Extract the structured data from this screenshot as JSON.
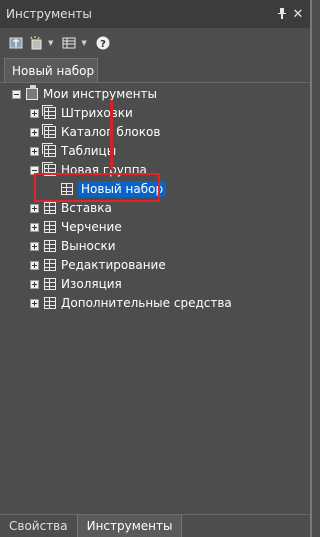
{
  "window": {
    "title": "Инструменты",
    "pin_symbol": "ᵽ",
    "close_symbol": "✕"
  },
  "toolbar": {
    "icons": [
      "properties-icon",
      "new-palette-icon",
      "view-options-icon",
      "help-icon"
    ],
    "help_symbol": "?"
  },
  "tabs": {
    "active_label": "Новый набор"
  },
  "tree": {
    "root_label": "Мои инструменты",
    "items": [
      {
        "label": "Штриховки",
        "level": 1,
        "expander": "plus"
      },
      {
        "label": "Каталог блоков",
        "level": 1,
        "expander": "plus"
      },
      {
        "label": "Таблицы",
        "level": 1,
        "expander": "plus"
      },
      {
        "label": "Новая группа",
        "level": 1,
        "expander": "minus"
      },
      {
        "label": "Новый набор",
        "level": 2,
        "selected": true
      },
      {
        "label": "Вставка",
        "level": 1,
        "expander": "plus"
      },
      {
        "label": "Черчение",
        "level": 1,
        "expander": "plus"
      },
      {
        "label": "Выноски",
        "level": 1,
        "expander": "plus"
      },
      {
        "label": "Редактирование",
        "level": 1,
        "expander": "plus"
      },
      {
        "label": "Изоляция",
        "level": 1,
        "expander": "plus"
      },
      {
        "label": "Дополнительные средства",
        "level": 1,
        "expander": "plus"
      }
    ]
  },
  "bottom_tabs": {
    "properties_label": "Свойства",
    "tools_label": "Инструменты"
  },
  "colors": {
    "background": "#4d4d4d",
    "selection": "#0a64c8",
    "annotation": "#e1232a"
  }
}
